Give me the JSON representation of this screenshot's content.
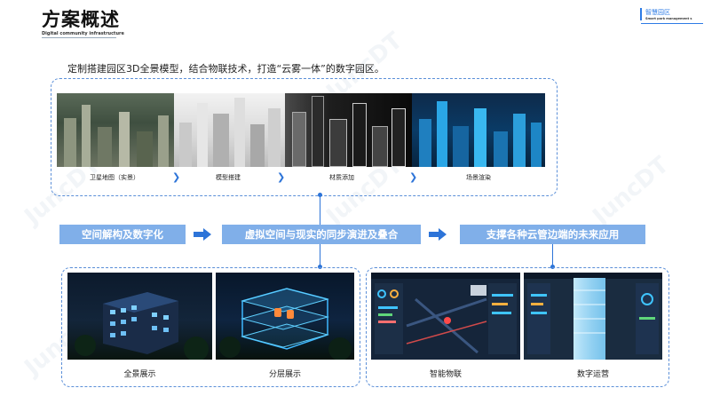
{
  "header": {
    "title": "方案概述",
    "subtitle": "Digital community infrastructure",
    "tag_cn": "智慧园区",
    "tag_en": "Smart park management s"
  },
  "tagline": "定制搭建园区3D全景模型，结合物联技术，打造“云雾一体”的数字园区。",
  "steps": [
    {
      "label": "卫星地图（实景）"
    },
    {
      "label": "模型搭建"
    },
    {
      "label": "材质添加"
    },
    {
      "label": "场景渲染"
    }
  ],
  "flow": [
    {
      "label": "空间解构及数字化"
    },
    {
      "label": "虚拟空间与现实的同步演进及叠合"
    },
    {
      "label": "支撑各种云管边端的未来应用"
    }
  ],
  "panels": [
    {
      "label": "全景展示"
    },
    {
      "label": "分层展示"
    },
    {
      "label": "智能物联"
    },
    {
      "label": "数字运营"
    }
  ],
  "watermark": "JuncDT",
  "colors": {
    "accent": "#2d74d8",
    "flow_fill": "#80afe9",
    "dash": "#5b8fd8"
  }
}
